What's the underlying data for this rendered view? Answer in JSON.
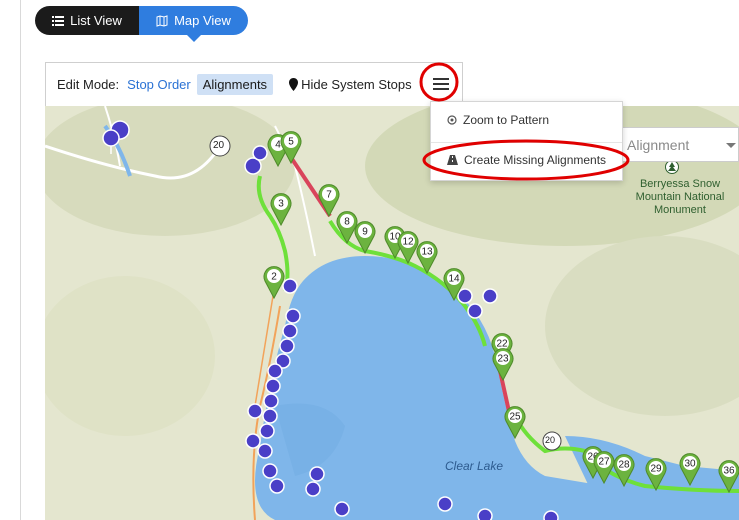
{
  "view_toggle": {
    "list_label": "List View",
    "map_label": "Map View"
  },
  "toolbar": {
    "edit_mode_label": "Edit Mode:",
    "stop_order_label": "Stop Order",
    "alignments_label": "Alignments",
    "hide_stops_label": "Hide System Stops"
  },
  "menu": {
    "zoom_label": "Zoom to Pattern",
    "create_label": "Create Missing Alignments"
  },
  "alignment_select": {
    "value": "Alignment"
  },
  "map": {
    "lake_label": "Clear Lake",
    "monument_label": "Berryessa Snow Mountain National Monument",
    "highway_label": "20",
    "highway_label_2": "20",
    "stops": [
      "2",
      "3",
      "4",
      "5",
      "7",
      "8",
      "9",
      "10",
      "12",
      "13",
      "14",
      "22",
      "23",
      "25",
      "26",
      "27",
      "28",
      "29",
      "30",
      "36"
    ]
  },
  "colors": {
    "accent": "#2f7ddf",
    "stop_green": "#6cb33f",
    "system_stop": "#4a3fc7",
    "route_green": "#6ee03a",
    "route_red": "#d9445b",
    "annotation": "#e00000"
  }
}
